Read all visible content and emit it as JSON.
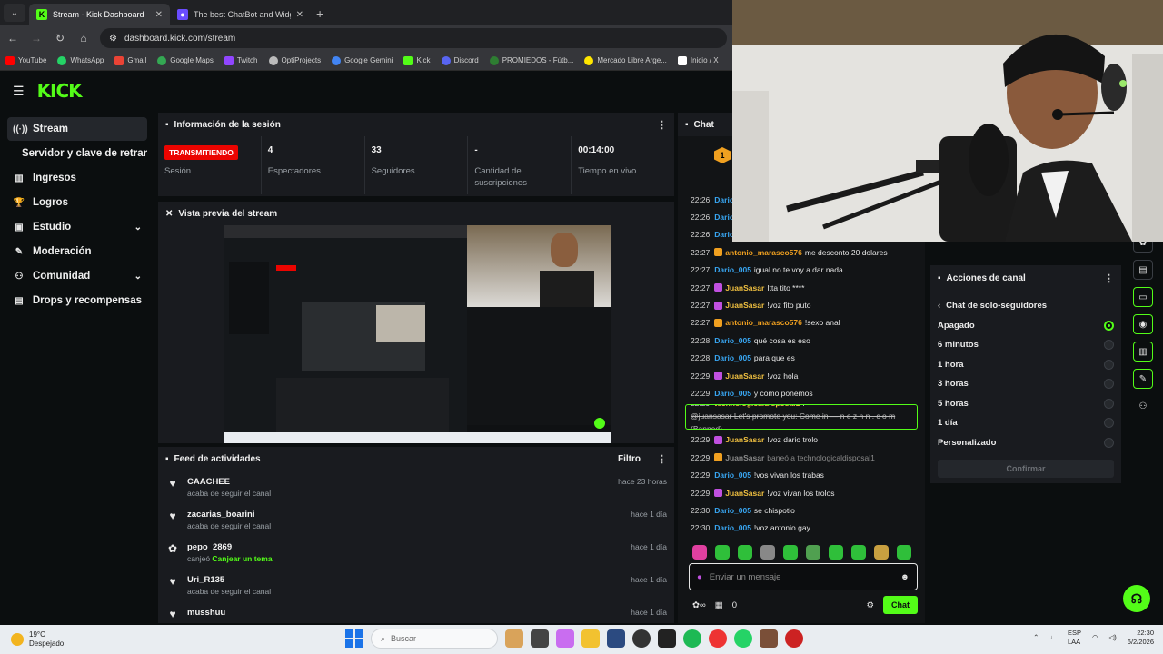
{
  "browser": {
    "tabs": [
      {
        "title": "Stream - Kick Dashboard",
        "active": true
      },
      {
        "title": "The best ChatBot and Widgets",
        "active": false
      }
    ],
    "new_tab": "+",
    "url": "dashboard.kick.com/stream",
    "bookmarks": [
      {
        "label": "YouTube",
        "color": "#ff0000"
      },
      {
        "label": "WhatsApp",
        "color": "#25d366"
      },
      {
        "label": "Gmail",
        "color": "#ea4335"
      },
      {
        "label": "Google Maps",
        "color": "#34a853"
      },
      {
        "label": "Twitch",
        "color": "#9146ff"
      },
      {
        "label": "OptiProjects",
        "color": "#bbbbbb"
      },
      {
        "label": "Google Gemini",
        "color": "#4285f4"
      },
      {
        "label": "Kick",
        "color": "#53fc18"
      },
      {
        "label": "Discord",
        "color": "#5865f2"
      },
      {
        "label": "PROMIEDOS - Fútb...",
        "color": "#2e7d32"
      },
      {
        "label": "Mercado Libre Arge...",
        "color": "#ffe600"
      },
      {
        "label": "Inicio / X",
        "color": "#ffffff"
      }
    ]
  },
  "kick": {
    "logo": "KICK",
    "sidebar": [
      {
        "label": "Stream",
        "icon": "broadcast-icon",
        "glyph": "((·))",
        "active": true
      },
      {
        "label": "Servidor y clave de retransmisión",
        "icon": "",
        "glyph": "",
        "sub": true
      },
      {
        "label": "Ingresos",
        "icon": "bank-icon",
        "glyph": "▥"
      },
      {
        "label": "Logros",
        "icon": "trophy-icon",
        "glyph": "🏆"
      },
      {
        "label": "Estudio",
        "icon": "studio-icon",
        "glyph": "▣",
        "chevron": true
      },
      {
        "label": "Moderación",
        "icon": "wrench-icon",
        "glyph": "✎"
      },
      {
        "label": "Comunidad",
        "icon": "people-icon",
        "glyph": "⚇",
        "chevron": true
      },
      {
        "label": "Drops y recompensas",
        "icon": "gift-icon",
        "glyph": "▤"
      }
    ],
    "session": {
      "title": "Información de la sesión",
      "stats": [
        {
          "value": "TRANSMITIENDO",
          "label": "Sesión",
          "badge": true
        },
        {
          "value": "4",
          "label": "Espectadores"
        },
        {
          "value": "33",
          "label": "Seguidores"
        },
        {
          "value": "-",
          "label": "Cantidad de suscripciones"
        },
        {
          "value": "00:14:00",
          "label": "Tiempo en vivo"
        }
      ]
    },
    "preview": {
      "title": "Vista previa del stream"
    },
    "feed": {
      "title": "Feed de actividades",
      "filter": "Filtro",
      "items": [
        {
          "icon": "heart-icon",
          "glyph": "♥",
          "name": "CAACHEE",
          "sub": "acaba de seguir el canal",
          "highlight": "",
          "time": "hace 23 horas"
        },
        {
          "icon": "heart-icon",
          "glyph": "♥",
          "name": "zacarias_boarini",
          "sub": "acaba de seguir el canal",
          "highlight": "",
          "time": "hace 1 día"
        },
        {
          "icon": "redeem-icon",
          "glyph": "✿",
          "name": "pepo_2869",
          "sub": "canjeó ",
          "highlight": "Canjear un tema",
          "time": "hace 1 día"
        },
        {
          "icon": "heart-icon",
          "glyph": "♥",
          "name": "Uri_R135",
          "sub": "acaba de seguir el canal",
          "highlight": "",
          "time": "hace 1 día"
        },
        {
          "icon": "heart-icon",
          "glyph": "♥",
          "name": "musshuu",
          "sub": "",
          "highlight": "",
          "time": "hace 1 día"
        }
      ]
    },
    "chat": {
      "title": "Chat",
      "pinned_count": "1",
      "messages": [
        {
          "time": "22:26",
          "user": "Dario_00",
          "text": "",
          "color": "#38a6f2"
        },
        {
          "time": "22:26",
          "user": "Dario_00",
          "text": "",
          "color": "#38a6f2"
        },
        {
          "time": "22:26",
          "user": "Dario_00",
          "text": "",
          "color": "#38a6f2"
        },
        {
          "time": "22:27",
          "user": "antonio_marasco576",
          "text": "me desconto 20 dolares",
          "color": "#f0a020",
          "badge": "#f0a020"
        },
        {
          "time": "22:27",
          "user": "Dario_005",
          "text": "igual no te voy a dar nada",
          "color": "#38a6f2"
        },
        {
          "time": "22:27",
          "user": "JuanSasar",
          "text": "Itta tito ****",
          "color": "#f0c040",
          "badge": "#c050e0"
        },
        {
          "time": "22:27",
          "user": "JuanSasar",
          "text": "!voz fito puto",
          "color": "#f0c040",
          "badge": "#c050e0"
        },
        {
          "time": "22:27",
          "user": "antonio_marasco576",
          "text": "!sexo anal",
          "color": "#f0a020",
          "badge": "#f0a020"
        },
        {
          "time": "22:28",
          "user": "Dario_005",
          "text": "qué cosa es eso",
          "color": "#38a6f2"
        },
        {
          "time": "22:28",
          "user": "Dario_005",
          "text": "para que es",
          "color": "#38a6f2"
        },
        {
          "time": "22:29",
          "user": "JuanSasar",
          "text": "!voz hola",
          "color": "#f0c040",
          "badge": "#c050e0"
        },
        {
          "time": "22:29",
          "user": "Dario_005",
          "text": "y como ponemos",
          "color": "#38a6f2"
        },
        {
          "time": "22:29",
          "user": "technologicaldisposal1",
          "text": "@juansasar Let's promote you: Come in — n e z h n . c o m",
          "banned": "(Banned)",
          "color": "#f0c040",
          "boxed": true
        },
        {
          "time": "22:29",
          "user": "JuanSasar",
          "text": "!voz dario trolo",
          "color": "#f0c040",
          "badge": "#c050e0"
        },
        {
          "time": "22:29",
          "user": "JuanSasar",
          "text": "baneó a technologicaldisposal1",
          "color": "#8a8a8a",
          "badge": "#f0a020",
          "mod": true
        },
        {
          "time": "22:29",
          "user": "Dario_005",
          "text": "!vos vivan los trabas",
          "color": "#38a6f2"
        },
        {
          "time": "22:29",
          "user": "JuanSasar",
          "text": "!voz vivan los trolos",
          "color": "#f0c040",
          "badge": "#c050e0"
        },
        {
          "time": "22:30",
          "user": "Dario_005",
          "text": "se chispotio",
          "color": "#38a6f2"
        },
        {
          "time": "22:30",
          "user": "Dario_005",
          "text": "!voz antonio gay",
          "color": "#38a6f2"
        }
      ],
      "input_placeholder": "Enviar un mensaje",
      "footer_count": "0",
      "chat_button": "Chat"
    },
    "actions": {
      "title": "Acciones de canal",
      "subtitle": "Chat de solo-seguidores",
      "options": [
        {
          "label": "Apagado",
          "selected": true
        },
        {
          "label": "6 minutos",
          "selected": false
        },
        {
          "label": "1 hora",
          "selected": false
        },
        {
          "label": "3 horas",
          "selected": false
        },
        {
          "label": "5 horas",
          "selected": false
        },
        {
          "label": "1 día",
          "selected": false
        },
        {
          "label": "Personalizado",
          "selected": false
        }
      ],
      "confirm": "Confirmar"
    }
  },
  "taskbar": {
    "temp": "19°C",
    "weather": "Despejado",
    "search": "Buscar",
    "lang": "ESP",
    "layout": "LAA",
    "time": "22:30",
    "date": "6/2/2026"
  },
  "colors": {
    "kick_green": "#53fc18",
    "live_red": "#eb0400",
    "panel": "#191b1f",
    "background": "#0b0e0f"
  }
}
